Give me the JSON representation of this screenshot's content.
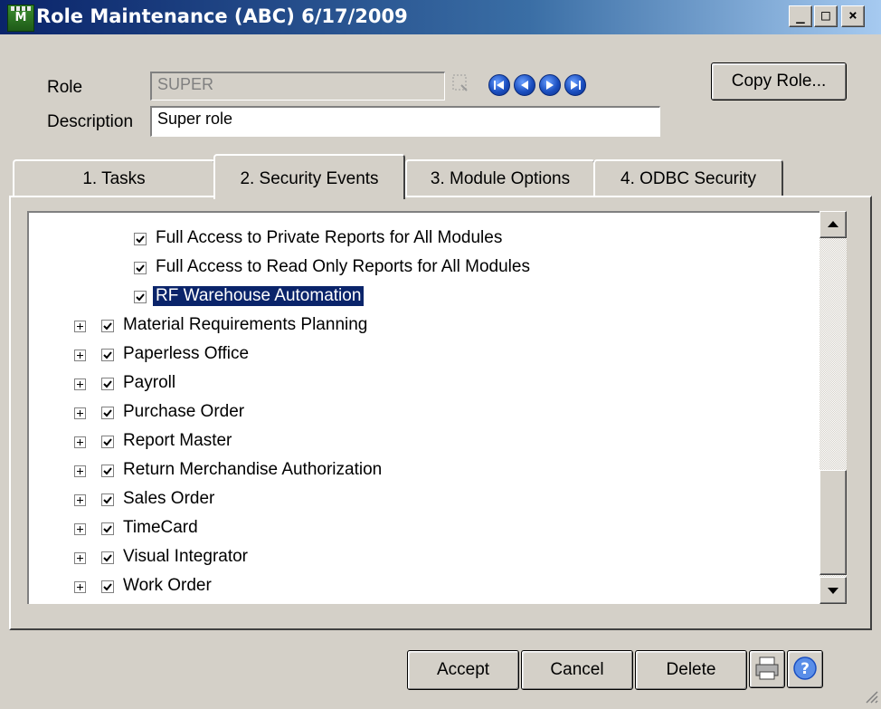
{
  "window": {
    "title": "Role Maintenance (ABC) 6/17/2009",
    "controls": {
      "minimize": "_",
      "maximize": "□",
      "close": "×"
    }
  },
  "form": {
    "role_label": "Role",
    "role_value": "SUPER",
    "description_label": "Description",
    "description_value": "Super role",
    "copy_role_label": "Copy Role..."
  },
  "tabs": [
    {
      "label": "1. Tasks",
      "active": false
    },
    {
      "label": "2. Security Events",
      "active": true
    },
    {
      "label": "3. Module Options",
      "active": false
    },
    {
      "label": "4. ODBC Security",
      "active": false
    }
  ],
  "tree": {
    "child_items": [
      {
        "label": "Full Access to Private Reports for All Modules",
        "checked": true
      },
      {
        "label": "Full Access to Read Only Reports for All Modules",
        "checked": true
      },
      {
        "label": "RF Warehouse Automation",
        "checked": true,
        "selected": true
      }
    ],
    "modules": [
      {
        "label": "Material Requirements Planning",
        "checked": true
      },
      {
        "label": "Paperless Office",
        "checked": true
      },
      {
        "label": "Payroll",
        "checked": true
      },
      {
        "label": "Purchase Order",
        "checked": true
      },
      {
        "label": "Report Master",
        "checked": true
      },
      {
        "label": "Return Merchandise Authorization",
        "checked": true
      },
      {
        "label": "Sales Order",
        "checked": true
      },
      {
        "label": "TimeCard",
        "checked": true
      },
      {
        "label": "Visual Integrator",
        "checked": true
      },
      {
        "label": "Work Order",
        "checked": true
      }
    ]
  },
  "buttons": {
    "accept": "Accept",
    "cancel": "Cancel",
    "delete": "Delete"
  },
  "colors": {
    "selection": "#0a246a",
    "face": "#d4d0c8",
    "nav": "#1b4fc0"
  }
}
